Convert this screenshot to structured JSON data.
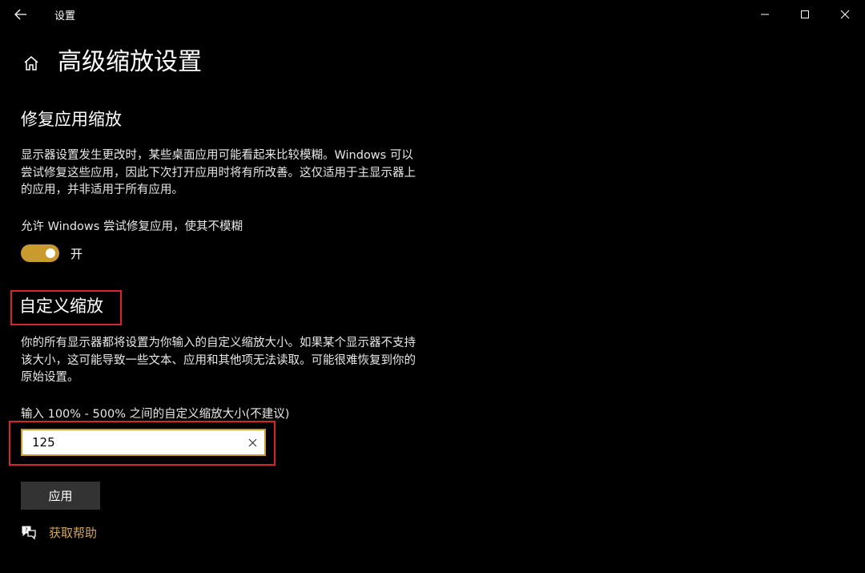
{
  "window": {
    "title": "设置",
    "back_icon": "arrow-left-icon",
    "minimize_icon": "minimize-icon",
    "maximize_icon": "maximize-icon",
    "close_icon": "close-icon"
  },
  "page": {
    "title": "高级缩放设置",
    "home_icon": "home-icon"
  },
  "fix_scaling": {
    "heading": "修复应用缩放",
    "description": "显示器设置发生更改时，某些桌面应用可能看起来比较模糊。Windows 可以尝试修复这些应用，因此下次打开应用时将有所改善。这仅适用于主显示器上的应用，并非适用于所有应用。",
    "toggle_label": "允许 Windows 尝试修复应用，使其不模糊",
    "toggle_state": "开",
    "toggle_on": true
  },
  "custom_scaling": {
    "heading": "自定义缩放",
    "description": "你的所有显示器都将设置为你输入的自定义缩放大小。如果某个显示器不支持该大小，这可能导致一些文本、应用和其他项无法读取。可能很难恢复到你的原始设置。",
    "input_label": "输入 100% - 500% 之间的自定义缩放大小(不建议)",
    "input_value": "125",
    "apply_label": "应用"
  },
  "help": {
    "icon": "chat-help-icon",
    "label": "获取帮助"
  },
  "colors": {
    "accent": "#c99a2e",
    "link": "#d3a65a",
    "highlight": "#d6262c",
    "background": "#000000"
  }
}
